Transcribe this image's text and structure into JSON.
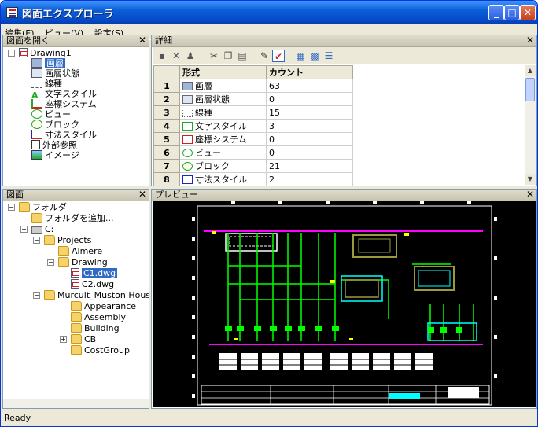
{
  "window": {
    "title": "図面エクスプローラ",
    "minimize_label": "_",
    "maximize_label": "□",
    "close_label": "✕"
  },
  "menu": [
    "編集(E)",
    "ビュー(V)",
    "設定(S)"
  ],
  "open_drawings_pane": {
    "title": "図面を開く",
    "close_label": "✕",
    "root": "Drawing1",
    "items": [
      "画層",
      "画層状態",
      "線種",
      "文字スタイル",
      "座標システム",
      "ビュー",
      "ブロック",
      "寸法スタイル",
      "外部参照",
      "イメージ"
    ]
  },
  "drawings_pane": {
    "title": "図面",
    "close_label": "✕",
    "nodes": [
      "フォルダ",
      "フォルダを追加...",
      "C:",
      "Projects",
      "Almere",
      "Drawing",
      "C1.dwg",
      "C2.dwg",
      "Murcult_Muston House",
      "Appearance",
      "Assembly",
      "Building",
      "CB",
      "CostGroup"
    ]
  },
  "details_pane": {
    "title": "詳細",
    "close_label": "✕",
    "columns": [
      "形式",
      "カウント"
    ],
    "rows": [
      {
        "num": "1",
        "type": "画層",
        "count": "63"
      },
      {
        "num": "2",
        "type": "画層状態",
        "count": "0"
      },
      {
        "num": "3",
        "type": "線種",
        "count": "15"
      },
      {
        "num": "4",
        "type": "文字スタイル",
        "count": "3"
      },
      {
        "num": "5",
        "type": "座標システム",
        "count": "0"
      },
      {
        "num": "6",
        "type": "ビュー",
        "count": "0"
      },
      {
        "num": "7",
        "type": "ブロック",
        "count": "21"
      },
      {
        "num": "8",
        "type": "寸法スタイル",
        "count": "2"
      }
    ]
  },
  "preview_pane": {
    "title": "プレビュー",
    "close_label": "✕"
  },
  "status": "Ready",
  "colors": {
    "title_bar": "#0a5fd8",
    "selection": "#316ac5",
    "cad_magenta": "#ff00ff",
    "cad_green": "#00ff00",
    "cad_cyan": "#00ffff",
    "cad_olive": "#9a9a3c"
  }
}
